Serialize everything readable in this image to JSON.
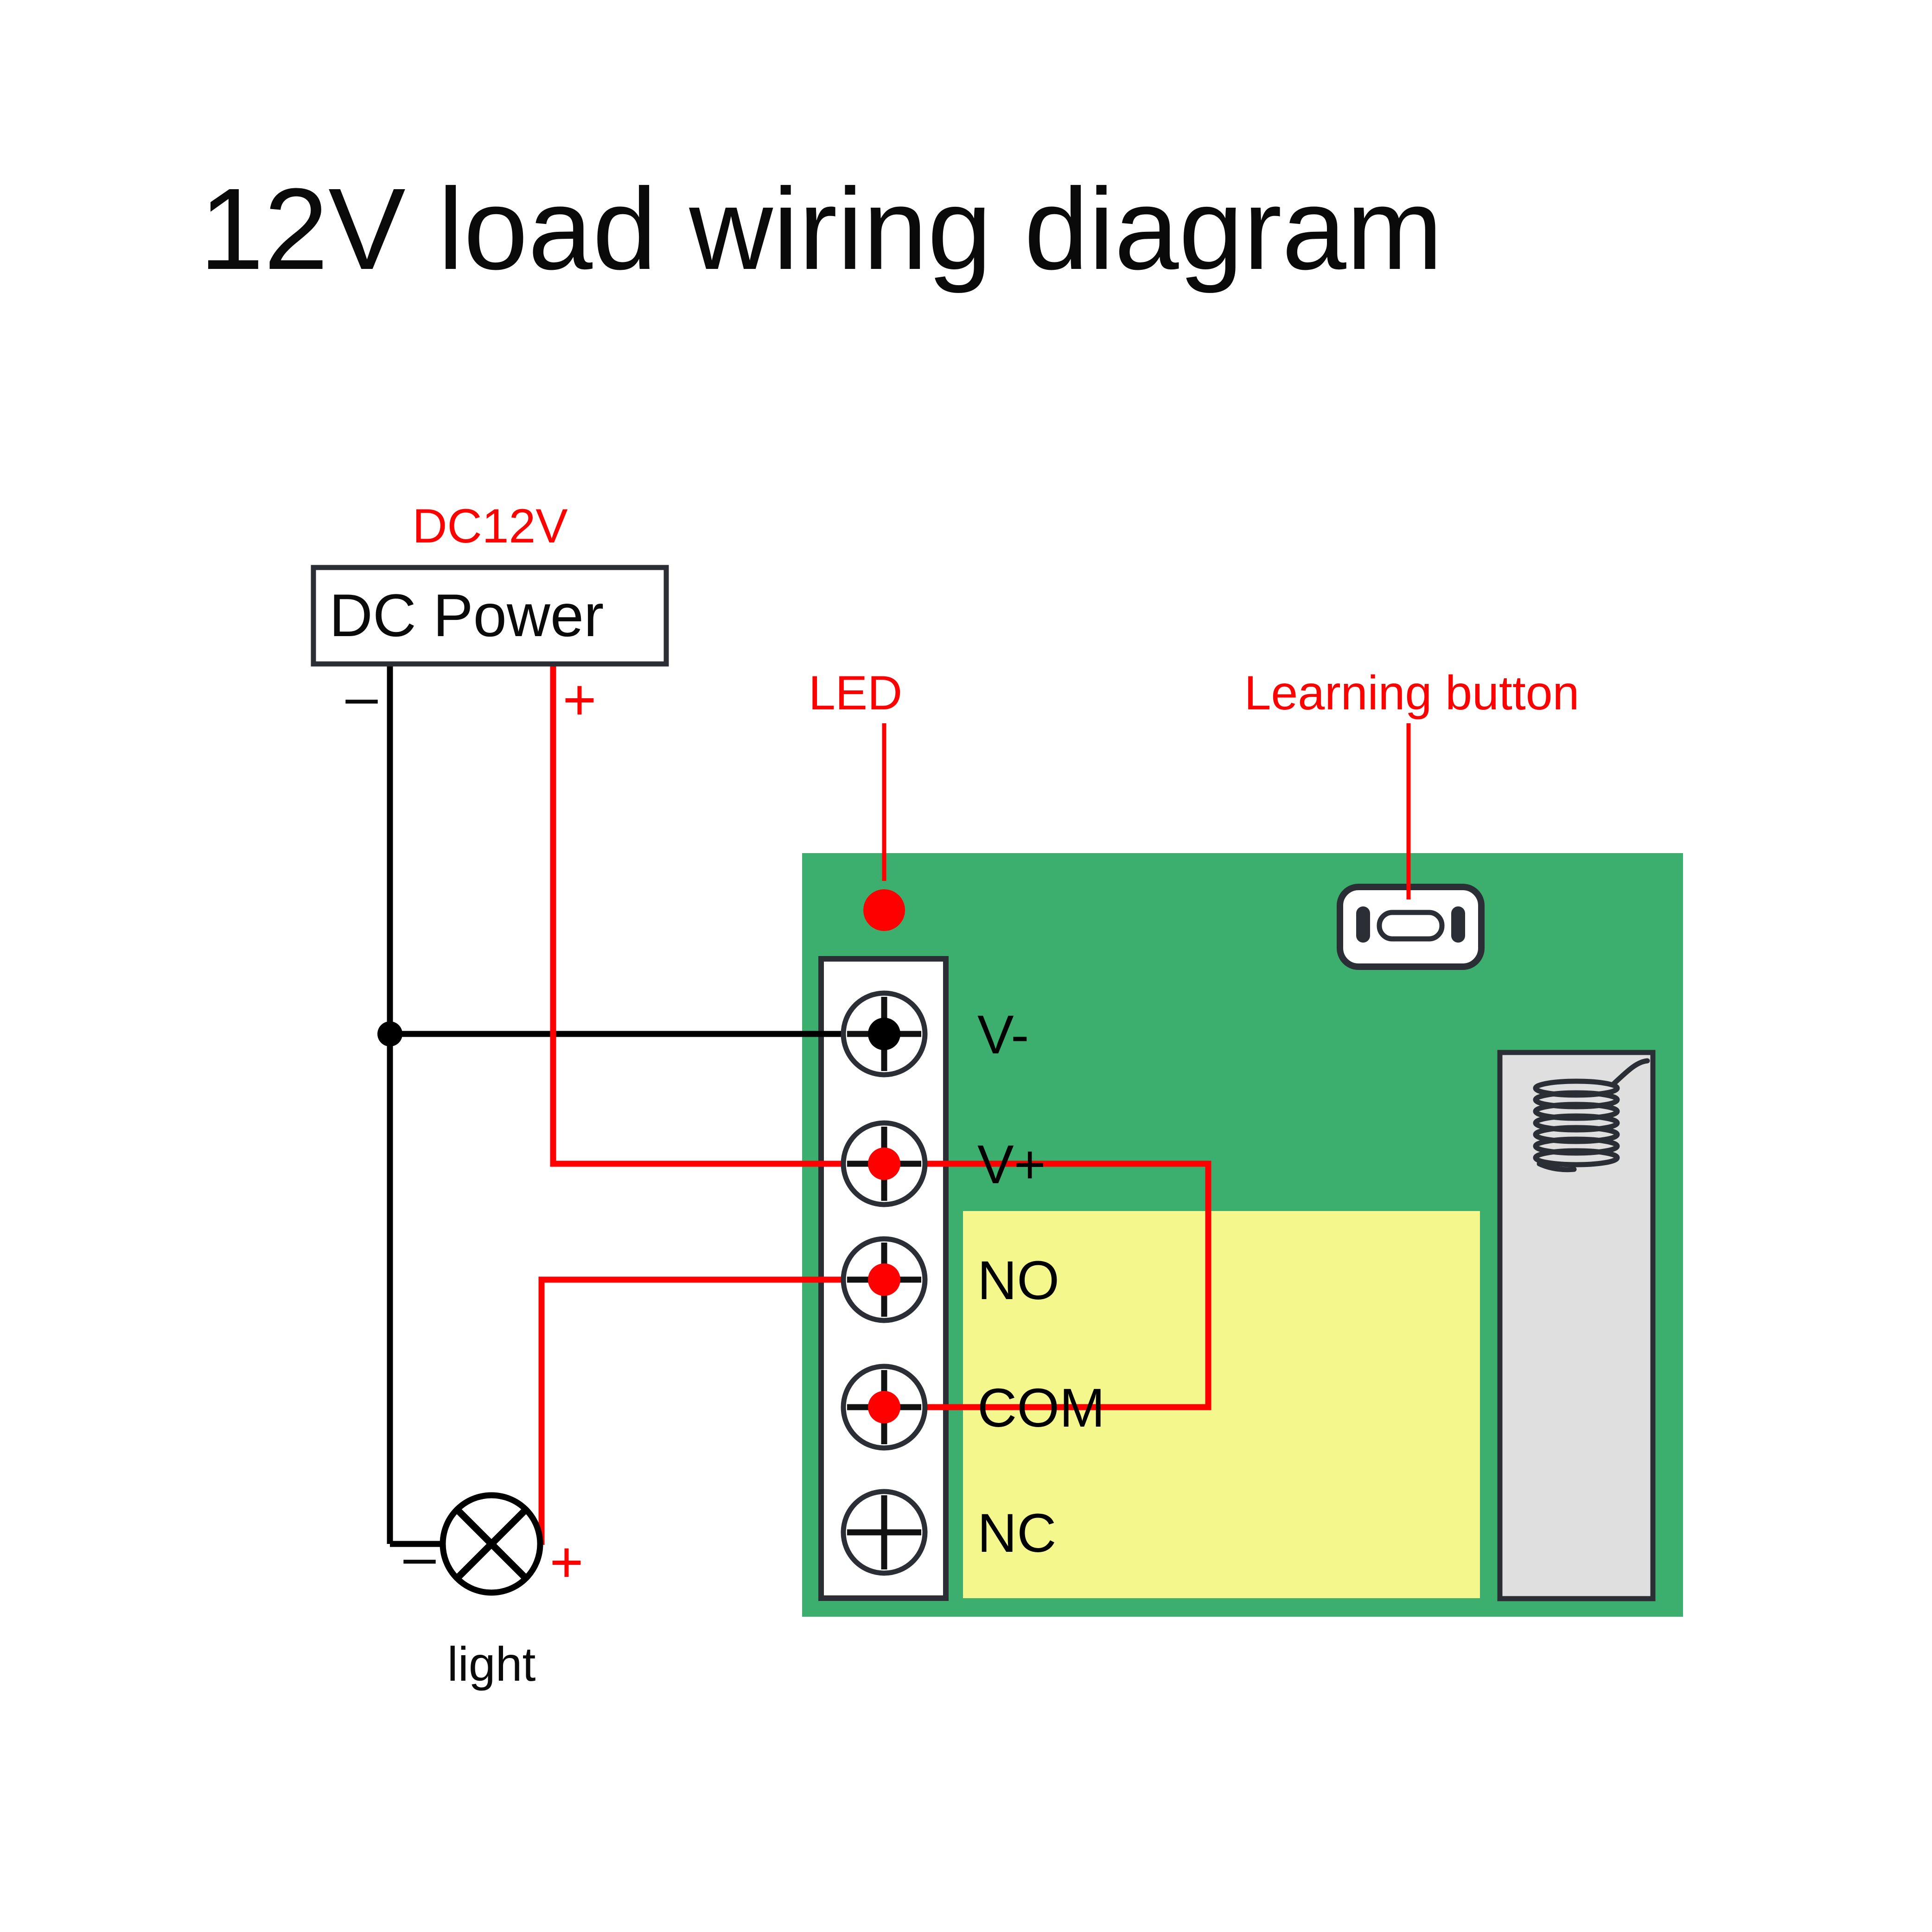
{
  "title": "12V load wiring diagram",
  "colors": {
    "pcb_green": "#3CAF6F",
    "relay_yellow": "#F4F88C",
    "module_gray": "#DFDFDF",
    "wire_red": "#FE0000",
    "wire_black": "#000000",
    "led_red": "#FE0000",
    "outline_dark": "#2B2F35",
    "label_red": "#FE0000",
    "text_black": "#0A0A0A"
  },
  "power_supply": {
    "voltage_label": "DC12V",
    "box_label": "DC Power",
    "negative_sign": "–",
    "positive_sign": "+"
  },
  "load": {
    "name": "light",
    "negative_sign": "–",
    "positive_sign": "+",
    "symbol": "lamp-cross-circle"
  },
  "board": {
    "led_label": "LED",
    "learning_button_label": "Learning button",
    "terminals": [
      {
        "label": "V-",
        "wire": "black",
        "connected": true
      },
      {
        "label": "V+",
        "wire": "red",
        "connected": true
      },
      {
        "label": "NO",
        "wire": "red",
        "connected": true
      },
      {
        "label": "COM",
        "wire": "red",
        "connected": true
      },
      {
        "label": "NC",
        "wire": "none",
        "connected": false
      }
    ],
    "components": {
      "relay_block": "relay",
      "receiver_module": "rf-receiver-module",
      "antenna": "coil-antenna"
    }
  },
  "connections": [
    {
      "from": "DC Power -",
      "to": "V-",
      "color": "black"
    },
    {
      "from": "DC Power -",
      "to": "light -",
      "color": "black"
    },
    {
      "from": "DC Power +",
      "to": "V+",
      "color": "red"
    },
    {
      "from": "V+",
      "to": "COM",
      "color": "red"
    },
    {
      "from": "NO",
      "to": "light +",
      "color": "red"
    }
  ]
}
